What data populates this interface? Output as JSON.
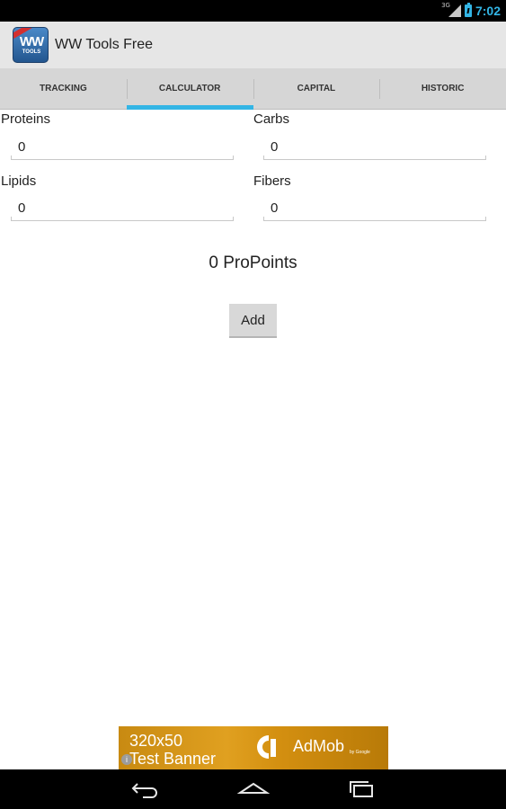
{
  "status_bar": {
    "network_type": "3G",
    "time": "7:02",
    "signal_icon": "signal-icon",
    "battery_icon": "battery-icon"
  },
  "action_bar": {
    "app_icon": "ww-tools-app-icon",
    "app_icon_text": "WW",
    "app_icon_subtext": "TOOLS",
    "title": "WW Tools Free"
  },
  "tabs": [
    {
      "label": "TRACKING",
      "active": false
    },
    {
      "label": "CALCULATOR",
      "active": true
    },
    {
      "label": "CAPITAL",
      "active": false
    },
    {
      "label": "HISTORIC",
      "active": false
    }
  ],
  "form": {
    "proteins": {
      "label": "Proteins",
      "value": "0"
    },
    "carbs": {
      "label": "Carbs",
      "value": "0"
    },
    "lipids": {
      "label": "Lipids",
      "value": "0"
    },
    "fibers": {
      "label": "Fibers",
      "value": "0"
    }
  },
  "result": {
    "points": "0",
    "unit": "ProPoints"
  },
  "add_button": {
    "label": "Add"
  },
  "ad_banner": {
    "size_text": "320x50",
    "text": "Test Banner",
    "brand": "AdMob",
    "by": "by Google",
    "info_icon": "info-icon"
  },
  "nav_bar": {
    "back_icon": "back-icon",
    "home_icon": "home-icon",
    "recents_icon": "recent-apps-icon"
  },
  "colors": {
    "accent": "#33b5e5",
    "action_bar": "#e6e6e6",
    "tab_bar": "#d6d6d6",
    "ad_gold": "#d69618"
  }
}
